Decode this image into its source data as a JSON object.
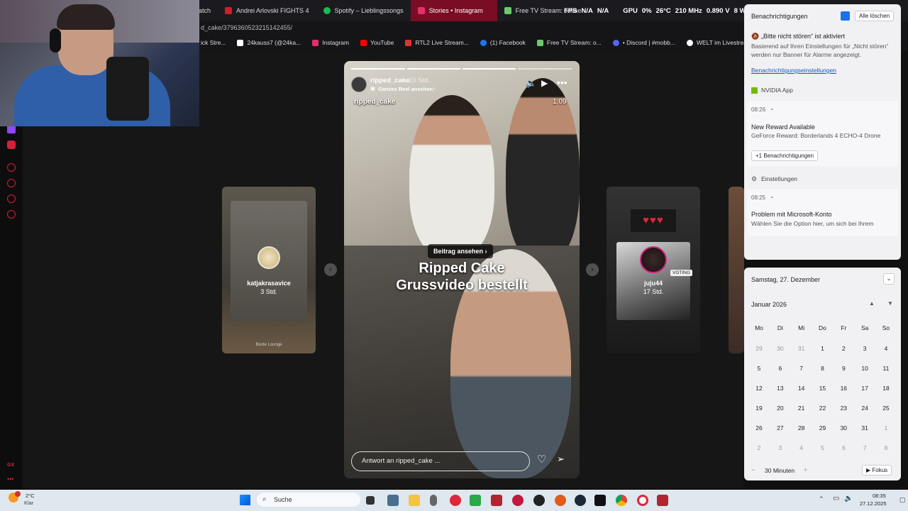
{
  "tabs": [
    {
      "label": "atch",
      "color": "#888"
    },
    {
      "label": "Andrei Arlovski FIGHTS 4",
      "color": "#d31d2a"
    },
    {
      "label": "Spotify – Lieblingssongs",
      "color": "#1db954"
    },
    {
      "label": "Stories • Instagram",
      "color": "#e1306c",
      "active": true
    },
    {
      "label": "Free TV Stream: online",
      "color": "#6ec96e"
    }
  ],
  "hud": {
    "fps": "FPS",
    "fps_val1": "N/A",
    "fps_val2": "N/A",
    "gpu": "GPU",
    "gpu_pct": "0%",
    "temp": "26°C",
    "clock": "210 MHz",
    "volt": "0.890 V",
    "watt": "8 W"
  },
  "url": "d_cake/3796360523215142455/",
  "bookmarks": [
    {
      "label": "ick Stre...",
      "color": "#777"
    },
    {
      "label": "24kauss7 (@24ka...",
      "color": "#333"
    },
    {
      "label": "Instagram",
      "color": "#e1306c"
    },
    {
      "label": "YouTube",
      "color": "#ff0000"
    },
    {
      "label": "RTL2 Live Stream...",
      "color": "#d33"
    },
    {
      "label": "(1) Facebook",
      "color": "#1877f2"
    },
    {
      "label": "Free TV Stream: o...",
      "color": "#6ec96e"
    },
    {
      "label": "• Discord | #mobb...",
      "color": "#5865f2"
    },
    {
      "label": "WELT im Livestrea...",
      "color": "#444"
    }
  ],
  "story": {
    "username": "ripped_cake",
    "age": "10 Std.",
    "reel_link": "Ganzes Reel ansehen",
    "overlay_user": "ripped_cake",
    "time": "1:09",
    "see_post": "Beitrag ansehen",
    "caption_line1": "Ripped Cake",
    "caption_line2": "Grussvideo bestellt",
    "reply_placeholder": "Antwort an ripped_cake ..."
  },
  "left_card": {
    "name": "katjakrasavice",
    "age": "3 Std.",
    "footer": "Beste Lounge"
  },
  "right_card": {
    "name": "juju44",
    "age": "17 Std.",
    "badge": "VOTING",
    "hearts": "♥♥♥"
  },
  "notifications": {
    "title": "Benachrichtigungen",
    "clear_all": "Alle löschen",
    "dnd_title": "„Bitte nicht stören“ ist aktiviert",
    "dnd_body": "Basierend auf Ihren Einstellungen für „Nicht stören“ werden nur Banner für Alarme angezeigt.",
    "settings_link": "Benachrichtigungseinstellungen",
    "app1": "NVIDIA App",
    "time1": "08:26",
    "n1_title": "New Reward Available",
    "n1_body": "GeForce Reward: Borderlands 4 ECHO-4 Drone",
    "more": "+1 Benachrichtigungen",
    "app2": "Einstellungen",
    "time2": "08:25",
    "n2_title": "Problem mit Microsoft-Konto",
    "n2_body": "Wählen Sie die Option hier, um sich bei Ihrem"
  },
  "calendar": {
    "date_header": "Samstag, 27. Dezember",
    "month": "Januar 2026",
    "weekdays": [
      "Mo",
      "Di",
      "Mi",
      "Do",
      "Fr",
      "Sa",
      "So"
    ],
    "weeks": [
      [
        "29",
        "30",
        "31",
        "1",
        "2",
        "3",
        "4"
      ],
      [
        "5",
        "6",
        "7",
        "8",
        "9",
        "10",
        "11"
      ],
      [
        "12",
        "13",
        "14",
        "15",
        "16",
        "17",
        "18"
      ],
      [
        "19",
        "20",
        "21",
        "22",
        "23",
        "24",
        "25"
      ],
      [
        "26",
        "27",
        "28",
        "29",
        "30",
        "31",
        "1"
      ],
      [
        "2",
        "3",
        "4",
        "5",
        "6",
        "7",
        "8"
      ]
    ],
    "focus_minutes": "30 Minuten",
    "focus_button": "Fokus"
  },
  "taskbar": {
    "weather_temp": "2°C",
    "weather_desc": "Klar",
    "search": "Suche",
    "time": "08:35",
    "date": "27.12.2025"
  },
  "misc": {
    "gx": "GX"
  }
}
